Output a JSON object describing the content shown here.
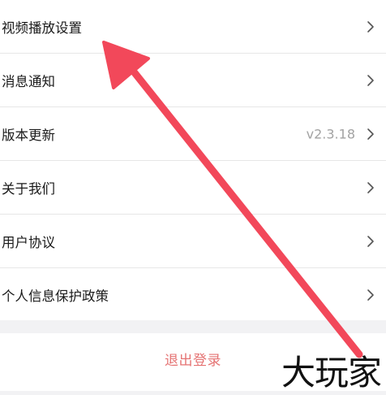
{
  "settings": {
    "items": [
      {
        "label": "视频播放设置",
        "value": ""
      },
      {
        "label": "消息通知",
        "value": ""
      },
      {
        "label": "版本更新",
        "value": "v2.3.18"
      },
      {
        "label": "关于我们",
        "value": ""
      },
      {
        "label": "用户协议",
        "value": ""
      },
      {
        "label": "个人信息保护政策",
        "value": ""
      }
    ]
  },
  "logout": {
    "label": "退出登录"
  },
  "watermark": {
    "text": "大玩家"
  },
  "colors": {
    "annotation_arrow": "#f2485a",
    "logout_text": "#e57373",
    "chevron": "#555555"
  },
  "icons": {
    "row_chevron": "chevron-right-icon",
    "annotation": "red-arrow-annotation"
  }
}
